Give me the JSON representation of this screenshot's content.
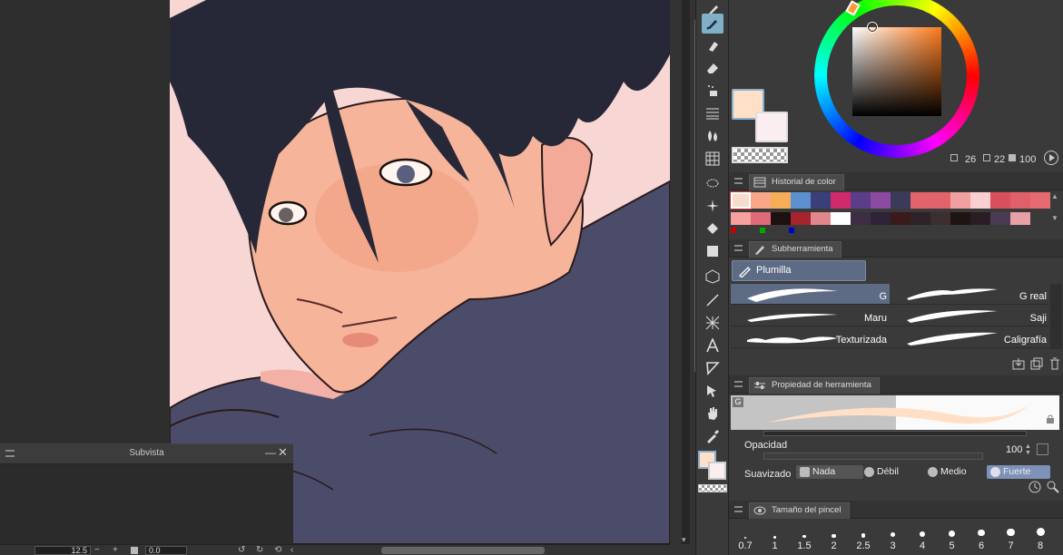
{
  "subview": {
    "title": "Subvista",
    "minimize": "—",
    "close": "✕"
  },
  "bottom_bar": {
    "zoom": "12.5",
    "minus": "−",
    "plus": "+",
    "angle": "0.0"
  },
  "colors": {
    "main": "#ffe0c6",
    "sub": "#fbeef0",
    "accent": "#5d6b85",
    "hsv": {
      "h": "26",
      "s": "22",
      "v": "100"
    }
  },
  "color_history": {
    "tab": "Historial de color",
    "row1": [
      "#f7dccc",
      "#f8a789",
      "#f6ad58",
      "#5b8fcf",
      "#3a3f79",
      "#d12a6c",
      "#5b3d8c",
      "#8c4aa2",
      "#3c3a5a",
      "#e0646a",
      "#e3636a",
      "#f0a0a0",
      "#fbcfcf",
      "#d9505d",
      "#e0606a",
      "#e66b70"
    ],
    "row2": [
      "#f6a0a0",
      "#e06a7a",
      "#1d1010",
      "#a6242e",
      "#e2868e",
      "#ffffff",
      "#3e2e44",
      "#2e2236",
      "#3a1a1a",
      "#2e2328",
      "#3c2f30",
      "#1e1414",
      "#2a1e24",
      "#4a3a52",
      "#e8a0a6"
    ],
    "marks": [
      "#cc0000",
      "#00aa00",
      "#0000cc"
    ]
  },
  "subtool": {
    "tab": "Subherramienta",
    "selected": "Plumilla",
    "brushes": [
      {
        "name": "G",
        "selected": true
      },
      {
        "name": "G real",
        "selected": false
      },
      {
        "name": "Maru",
        "selected": false
      },
      {
        "name": "Saji",
        "selected": false
      },
      {
        "name": "Texturizada",
        "selected": false
      },
      {
        "name": "Caligrafía",
        "selected": false
      }
    ]
  },
  "tool_property": {
    "tab": "Propiedad de herramienta",
    "brush_letter": "G",
    "opacity_label": "Opacidad",
    "opacity_value": "100",
    "opacity": 1.0,
    "smoothing_label": "Suavizado",
    "smoothing_options": [
      "Nada",
      "Débil",
      "Medio",
      "Fuerte"
    ],
    "smoothing_selected": "Fuerte"
  },
  "brush_size": {
    "tab": "Tamaño del pincel",
    "values": [
      "0.7",
      "1",
      "1.5",
      "2",
      "2.5",
      "3",
      "4",
      "5",
      "6",
      "7",
      "8"
    ]
  },
  "icons": {
    "toolbar": [
      "pen-icon",
      "pencil-icon",
      "marker-icon",
      "eraser-icon",
      "airbrush-icon",
      "lines-icon",
      "blend-icon",
      "grid-icon",
      "lasso-pen-icon",
      "sparkle-icon",
      "fill-bucket-icon",
      "gradient-icon",
      "3d-box-icon",
      "line-icon",
      "frame-icon",
      "text-icon",
      "balloon-icon",
      "operation-icon",
      "hand-icon",
      "eyedropper-icon"
    ]
  }
}
